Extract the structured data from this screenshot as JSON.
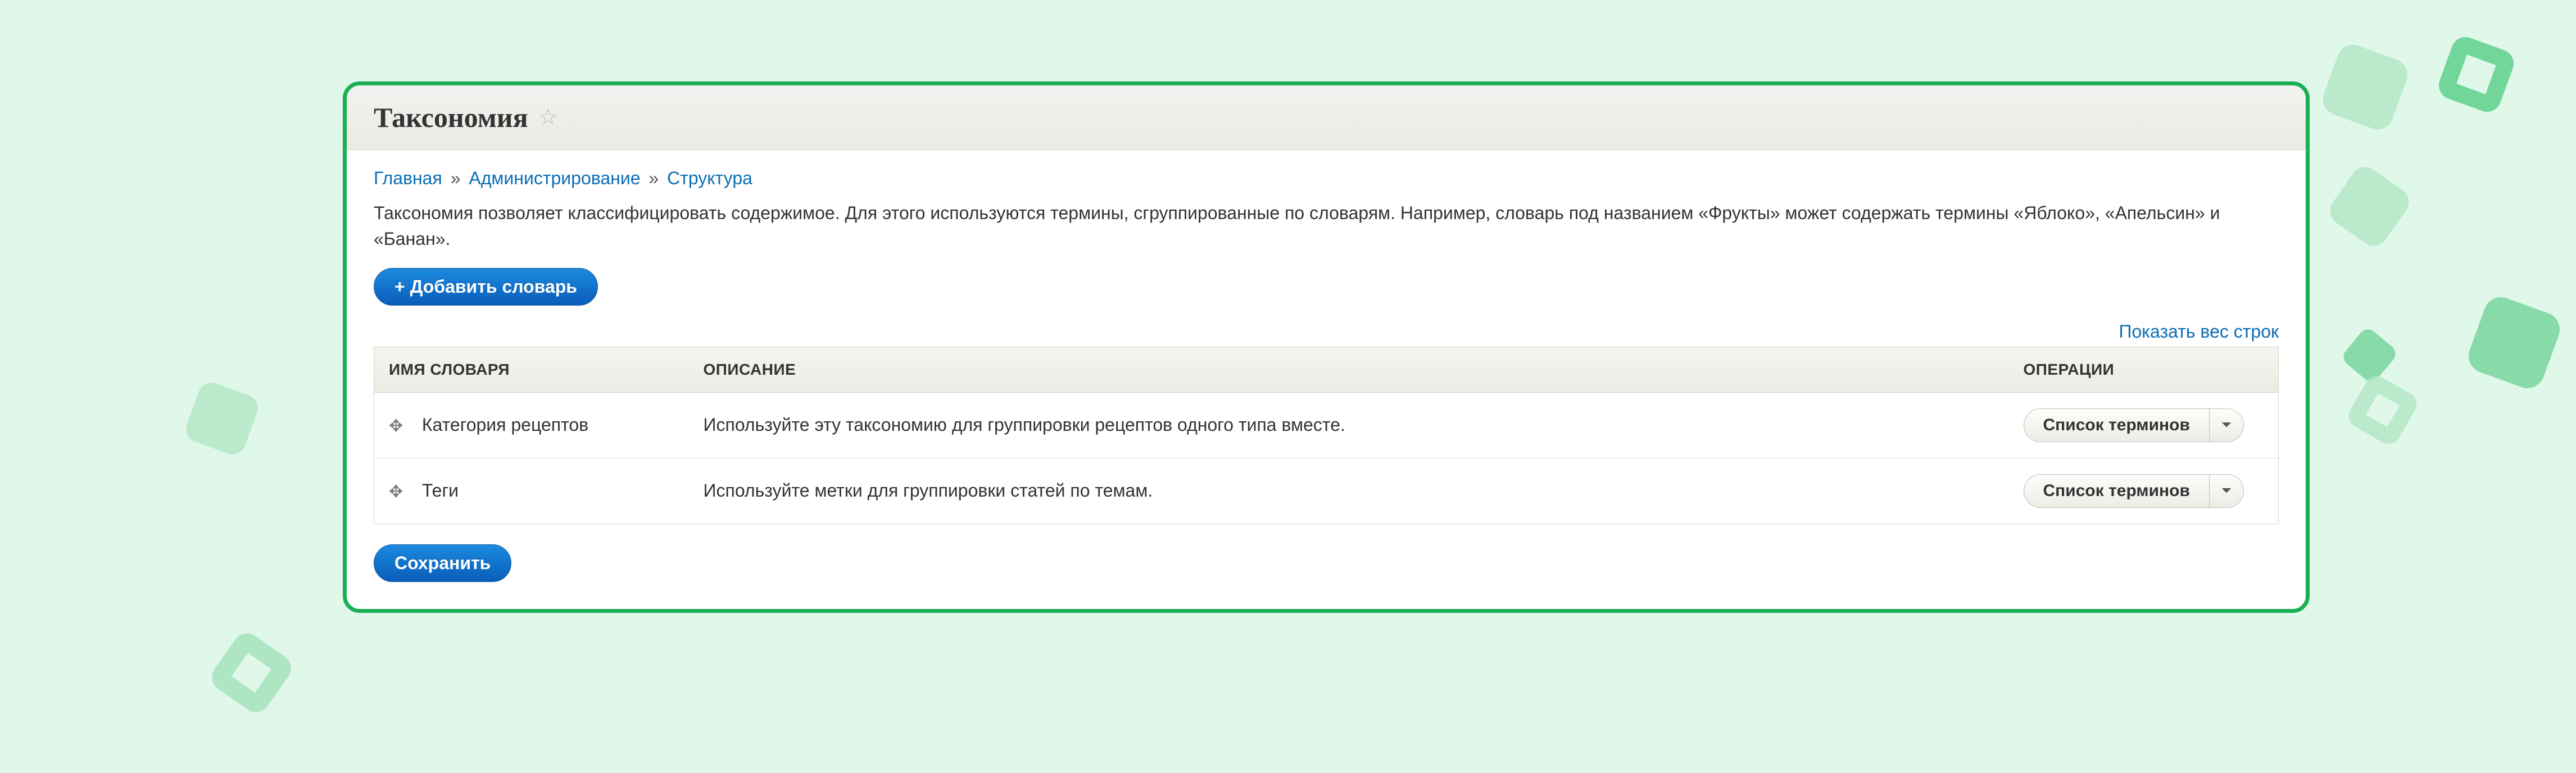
{
  "header": {
    "title": "Таксономия"
  },
  "breadcrumb": {
    "items": [
      "Главная",
      "Администрирование",
      "Структура"
    ]
  },
  "intro": "Таксономия позволяет классифицировать содержимое. Для этого используются термины, сгруппированные по словарям. Например, словарь под названием «Фрукты» может содержать термины «Яблоко», «Апельсин» и «Банан».",
  "buttons": {
    "add_vocabulary": "+ Добавить словарь",
    "save": "Сохранить"
  },
  "row_weights_toggle": "Показать вес строк",
  "table": {
    "columns": {
      "name": "ИМЯ СЛОВАРЯ",
      "description": "ОПИСАНИЕ",
      "operations": "ОПЕРАЦИИ"
    },
    "rows": [
      {
        "name": "Категория рецептов",
        "description": "Используйте эту таксономию для группировки рецептов одного типа вместе.",
        "op_label": "Список терминов"
      },
      {
        "name": "Теги",
        "description": "Используйте метки для группировки статей по темам.",
        "op_label": "Список терминов"
      }
    ]
  }
}
